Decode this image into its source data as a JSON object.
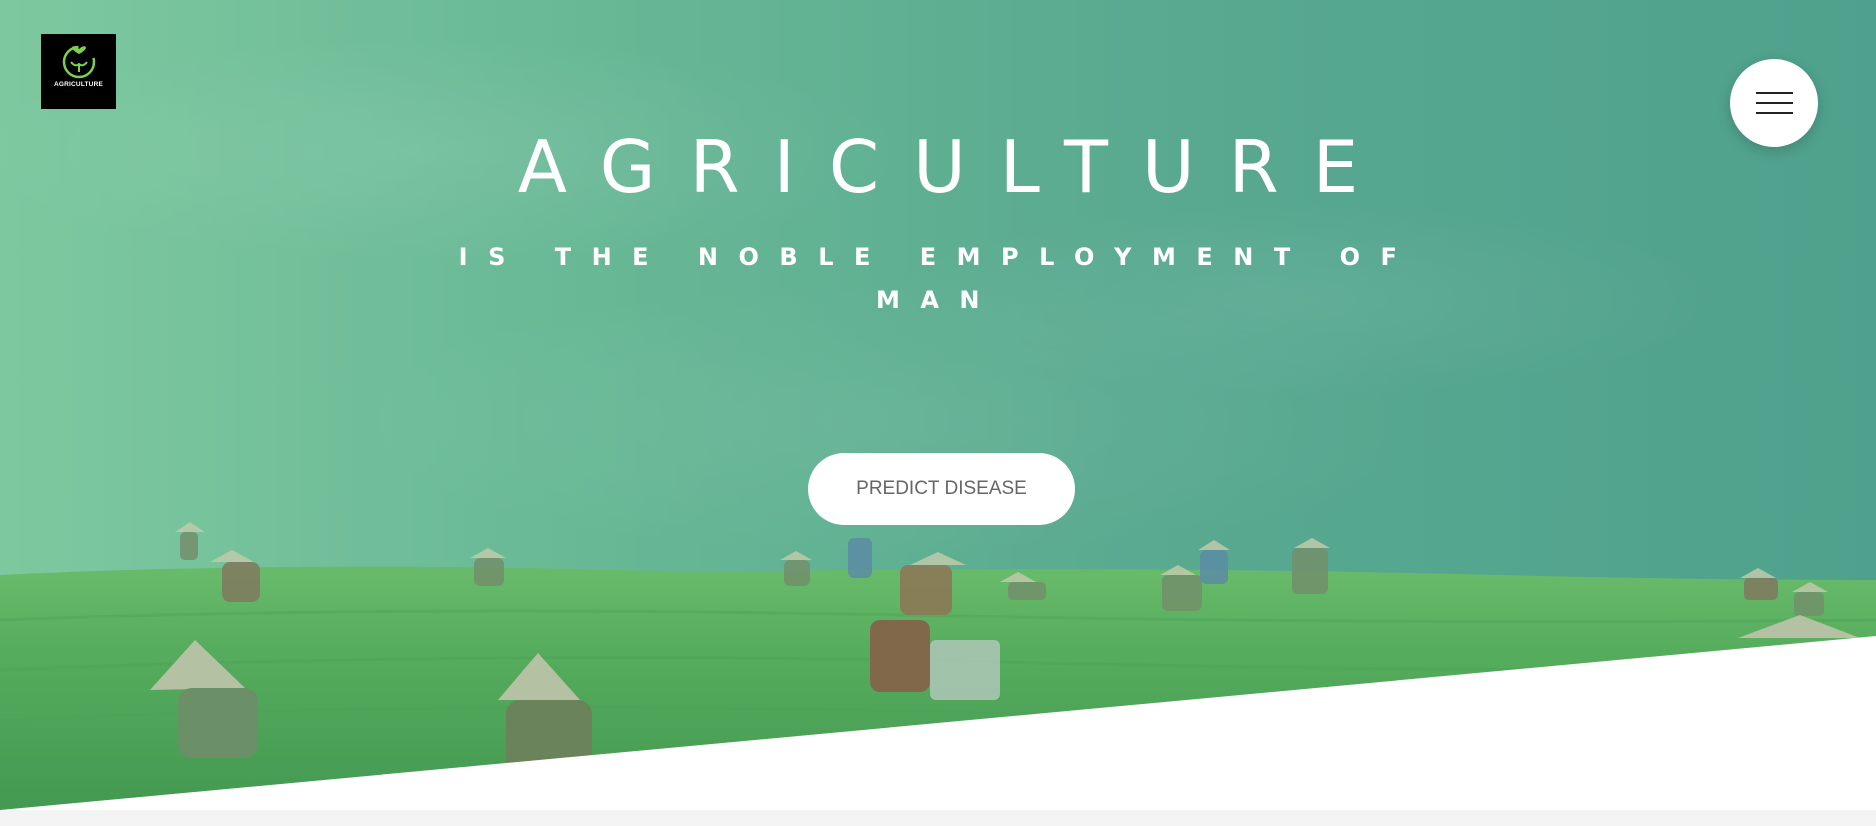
{
  "brand": {
    "logo_text": "AGRICULTURE",
    "logo_subtext": "· · · · · · · · ·",
    "logo_icon": "leaf-circle-icon",
    "logo_accent_color": "#7bd04e"
  },
  "nav": {
    "menu_icon": "hamburger-menu-icon"
  },
  "hero": {
    "title": "AGRICULTURE",
    "subtitle": "IS THE NOBLE EMPLOYMENT OF MAN",
    "cta_label": "PREDICT DISEASE",
    "overlay_color": "#5aaa91"
  }
}
